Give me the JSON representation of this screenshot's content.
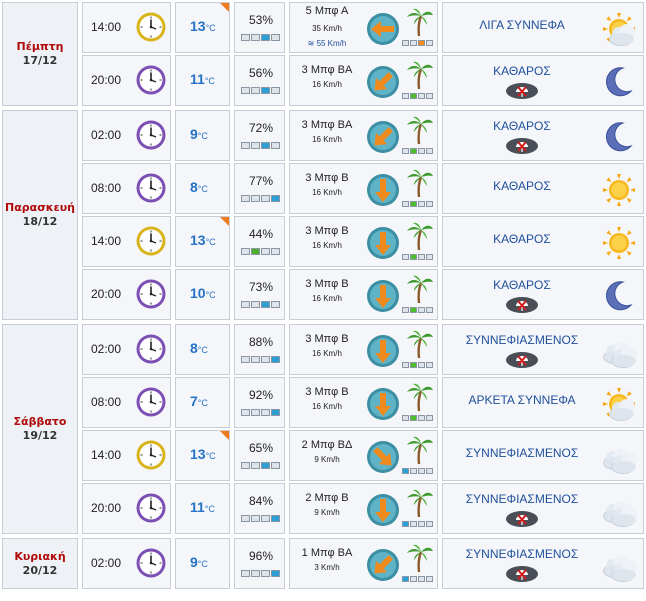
{
  "units": {
    "temp_unit": "°C"
  },
  "colors": {
    "day_name": "#b00a0a",
    "temp": "#2672c4",
    "sky_text": "#1f4f9c",
    "flag": "#f07a1e"
  },
  "days": [
    {
      "name": "Πέμπτη",
      "date": "17/12",
      "rows": [
        {
          "time": "14:00",
          "clock": "day",
          "temp": "13",
          "flag": true,
          "humidity": "53%",
          "hum_level": 3,
          "wind": "5 Μπφ Α",
          "kmh": "35 Km/h",
          "gust": "55 Km/h",
          "wind_dir": "west-arrow-icon",
          "wind_level": 3,
          "wind_color": "#f28c1b",
          "sky": "ΛΙΓΑ ΣΥΝΝΕΦΑ",
          "sky_icon": "sun-cloud-icon",
          "umbrella": false
        },
        {
          "time": "20:00",
          "clock": "night",
          "temp": "11",
          "flag": false,
          "humidity": "56%",
          "hum_level": 3,
          "wind": "3 Μπφ ΒΑ",
          "kmh": "16 Km/h",
          "gust": "",
          "wind_dir": "sw-arrow-icon",
          "wind_level": 2,
          "wind_color": "#4cbf2b",
          "sky": "ΚΑΘΑΡΟΣ",
          "sky_icon": "moon-icon",
          "umbrella": true
        }
      ]
    },
    {
      "name": "Παρασκευή",
      "date": "18/12",
      "rows": [
        {
          "time": "02:00",
          "clock": "night",
          "temp": "9",
          "flag": false,
          "humidity": "72%",
          "hum_level": 3,
          "wind": "3 Μπφ ΒΑ",
          "kmh": "16 Km/h",
          "gust": "",
          "wind_dir": "sw-arrow-icon",
          "wind_level": 2,
          "wind_color": "#4cbf2b",
          "sky": "ΚΑΘΑΡΟΣ",
          "sky_icon": "moon-icon",
          "umbrella": true
        },
        {
          "time": "08:00",
          "clock": "night",
          "temp": "8",
          "flag": false,
          "humidity": "77%",
          "hum_level": 4,
          "wind": "3 Μπφ Β",
          "kmh": "16 Km/h",
          "gust": "",
          "wind_dir": "south-arrow-icon",
          "wind_level": 2,
          "wind_color": "#4cbf2b",
          "sky": "ΚΑΘΑΡΟΣ",
          "sky_icon": "sun-icon",
          "umbrella": false
        },
        {
          "time": "14:00",
          "clock": "day",
          "temp": "13",
          "flag": true,
          "humidity": "44%",
          "hum_level": 2,
          "wind": "3 Μπφ Β",
          "kmh": "16 Km/h",
          "gust": "",
          "wind_dir": "south-arrow-icon",
          "wind_level": 2,
          "wind_color": "#4cbf2b",
          "sky": "ΚΑΘΑΡΟΣ",
          "sky_icon": "sun-icon",
          "umbrella": false
        },
        {
          "time": "20:00",
          "clock": "night",
          "temp": "10",
          "flag": false,
          "humidity": "73%",
          "hum_level": 3,
          "wind": "3 Μπφ Β",
          "kmh": "16 Km/h",
          "gust": "",
          "wind_dir": "south-arrow-icon",
          "wind_level": 2,
          "wind_color": "#4cbf2b",
          "sky": "ΚΑΘΑΡΟΣ",
          "sky_icon": "moon-icon",
          "umbrella": true
        }
      ]
    },
    {
      "name": "Σάββατο",
      "date": "19/12",
      "rows": [
        {
          "time": "02:00",
          "clock": "night",
          "temp": "8",
          "flag": false,
          "humidity": "88%",
          "hum_level": 4,
          "wind": "3 Μπφ Β",
          "kmh": "16 Km/h",
          "gust": "",
          "wind_dir": "south-arrow-icon",
          "wind_level": 2,
          "wind_color": "#4cbf2b",
          "sky": "ΣΥΝΝΕΦΙΑΣΜΕΝΟΣ",
          "sky_icon": "cloud-icon",
          "umbrella": true
        },
        {
          "time": "08:00",
          "clock": "night",
          "temp": "7",
          "flag": false,
          "humidity": "92%",
          "hum_level": 4,
          "wind": "3 Μπφ Β",
          "kmh": "16 Km/h",
          "gust": "",
          "wind_dir": "south-arrow-icon",
          "wind_level": 2,
          "wind_color": "#4cbf2b",
          "sky": "ΑΡΚΕΤΑ ΣΥΝΝΕΦΑ",
          "sky_icon": "sun-cloud-icon",
          "umbrella": false
        },
        {
          "time": "14:00",
          "clock": "day",
          "temp": "13",
          "flag": true,
          "humidity": "65%",
          "hum_level": 3,
          "wind": "2 Μπφ ΒΔ",
          "kmh": "9 Km/h",
          "gust": "",
          "wind_dir": "se-arrow-icon",
          "wind_level": 1,
          "wind_color": "#2b9fd6",
          "sky": "ΣΥΝΝΕΦΙΑΣΜΕΝΟΣ",
          "sky_icon": "cloud-icon",
          "umbrella": false
        },
        {
          "time": "20:00",
          "clock": "night",
          "temp": "11",
          "flag": false,
          "humidity": "84%",
          "hum_level": 4,
          "wind": "2 Μπφ Β",
          "kmh": "9 Km/h",
          "gust": "",
          "wind_dir": "south-arrow-icon",
          "wind_level": 1,
          "wind_color": "#2b9fd6",
          "sky": "ΣΥΝΝΕΦΙΑΣΜΕΝΟΣ",
          "sky_icon": "cloud-icon",
          "umbrella": true
        }
      ]
    },
    {
      "name": "Κυριακή",
      "date": "20/12",
      "rows": [
        {
          "time": "02:00",
          "clock": "night",
          "temp": "9",
          "flag": false,
          "humidity": "96%",
          "hum_level": 4,
          "wind": "1 Μπφ ΒΑ",
          "kmh": "3 Km/h",
          "gust": "",
          "wind_dir": "sw-arrow-icon",
          "wind_level": 1,
          "wind_color": "#2b9fd6",
          "sky": "ΣΥΝΝΕΦΙΑΣΜΕΝΟΣ",
          "sky_icon": "cloud-icon",
          "umbrella": true
        }
      ]
    }
  ]
}
